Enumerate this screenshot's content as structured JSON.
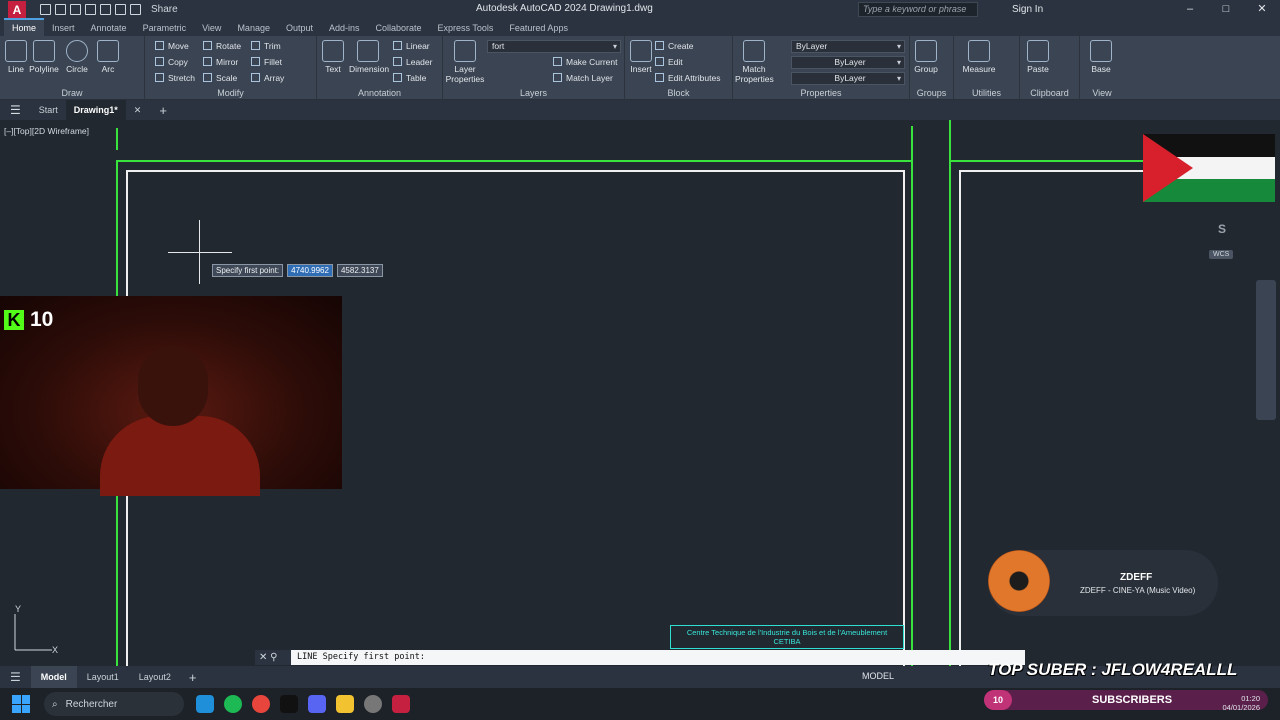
{
  "titlebar": {
    "app_icon": "A",
    "share": "Share",
    "title": "Autodesk AutoCAD 2024   Drawing1.dwg",
    "search_placeholder": "Type a keyword or phrase",
    "sign_in": "Sign In"
  },
  "ribbon_tabs": [
    "Home",
    "Insert",
    "Annotate",
    "Parametric",
    "View",
    "Manage",
    "Output",
    "Add-ins",
    "Collaborate",
    "Express Tools",
    "Featured Apps"
  ],
  "ribbon": {
    "draw": {
      "title": "Draw",
      "tools": [
        "Line",
        "Polyline",
        "Circle",
        "Arc"
      ]
    },
    "modify": {
      "title": "Modify",
      "tools": [
        "Move",
        "Rotate",
        "Trim",
        "Copy",
        "Mirror",
        "Fillet",
        "Stretch",
        "Scale",
        "Array"
      ]
    },
    "annotation": {
      "title": "Annotation",
      "tools": [
        "Text",
        "Dimension",
        "Linear",
        "Leader",
        "Table"
      ]
    },
    "layers": {
      "title": "Layers",
      "layer_props": "Layer Properties",
      "current_layer": "fort",
      "make_current": "Make Current",
      "match_layer": "Match Layer"
    },
    "block": {
      "title": "Block",
      "insert": "Insert",
      "create": "Create",
      "edit": "Edit",
      "edit_attributes": "Edit Attributes"
    },
    "properties": {
      "title": "Properties",
      "match": "Match Properties",
      "color": "ByLayer",
      "linetype": "ByLayer",
      "lineweight": "ByLayer"
    },
    "groups": {
      "title": "Groups",
      "group": "Group"
    },
    "utilities": {
      "title": "Utilities",
      "measure": "Measure"
    },
    "clipboard": {
      "title": "Clipboard",
      "paste": "Paste"
    },
    "view": {
      "title": "View",
      "base": "Base"
    }
  },
  "doc_tabs": {
    "start": "Start",
    "active": "Drawing1*"
  },
  "viewport": {
    "label": "[–][Top][2D Wireframe]",
    "prompt": "Specify first point:",
    "x_value": "4740.9962",
    "y_value": "4582.3137",
    "compass": "S",
    "wcs": "WCS",
    "titleblock_line1": "Centre Technique de l'Industrie du Bois et de l'Ameublement",
    "titleblock_line2": "CETIBA"
  },
  "overlays": {
    "kick_logo": "K",
    "kick_viewers": "10",
    "music_artist": "ZDEFF",
    "music_track": "ZDEFF - CINE-YA (Music Video)",
    "top_sub": "TOP SUBER : JFLOW4REALLL",
    "subs_count": "10",
    "subs_label": "SUBSCRIBERS"
  },
  "command_line": {
    "text": "LINE Specify first point:"
  },
  "status_bar": {
    "tabs": [
      "Model",
      "Layout1",
      "Layout2"
    ],
    "model_label": "MODEL"
  },
  "taskbar": {
    "search": "Rechercher",
    "time": "01:20",
    "date": "04/01/2026"
  },
  "colors": {
    "green_frame": "#39e23c",
    "white_frame": "#f0f0f0",
    "titleblock": "#2ee0d2",
    "accent": "#4fa0e0"
  }
}
